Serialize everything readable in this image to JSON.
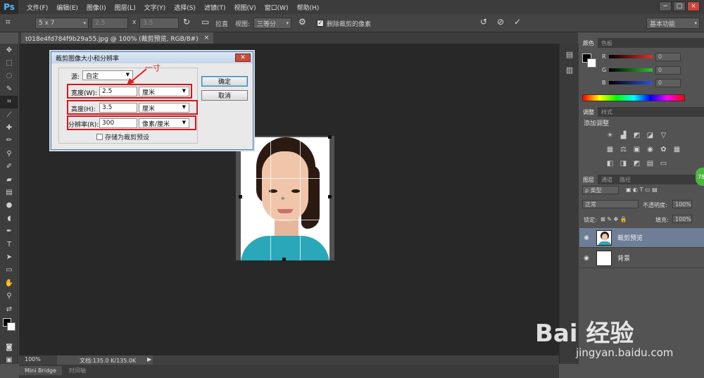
{
  "app": {
    "logo": "Ps",
    "menu": [
      "文件(F)",
      "编辑(E)",
      "图像(I)",
      "图层(L)",
      "文字(Y)",
      "选择(S)",
      "滤镜(T)",
      "视图(V)",
      "窗口(W)",
      "帮助(H)"
    ],
    "window_controls": [
      "−",
      "□",
      "×"
    ]
  },
  "options_bar": {
    "ratio_select": "5 x 7",
    "width_value": "2.5",
    "times": "x",
    "height_value": "3.5",
    "straighten_label": "拉直",
    "view_label": "视图:",
    "view_select": "三等分",
    "delete_cropped_label": "删除裁剪的像素",
    "workspace": "基本功能"
  },
  "document": {
    "tab_title": "t018e4fd784f9b29a55.jpg @ 100% (裁剪预览, RGB/8#)",
    "close_glyph": "×",
    "zoom": "100%",
    "doc_info": "文档:135.0 K/135.0K"
  },
  "dialog": {
    "title": "裁剪图像大小和分辨率",
    "close_glyph": "✕",
    "source_label": "源:",
    "source_value": "自定",
    "width_label": "宽度(W):",
    "width_value": "2.5",
    "width_unit": "厘米",
    "height_label": "高度(H):",
    "height_value": "3.5",
    "height_unit": "厘米",
    "resolution_label": "分辨率(R):",
    "resolution_value": "300",
    "resolution_unit": "像素/厘米",
    "save_preset_label": "存储为裁剪预设",
    "ok_label": "确定",
    "cancel_label": "取消"
  },
  "annotation": {
    "text": "一寸",
    "color": "#e01e1e"
  },
  "bottom_tabs": [
    "Mini Bridge",
    "时间轴"
  ],
  "panels": {
    "color_tabs": [
      "颜色",
      "色板"
    ],
    "channels": [
      {
        "label": "R",
        "value": "0",
        "color": "#e03030"
      },
      {
        "label": "G",
        "value": "0",
        "color": "#30c030"
      },
      {
        "label": "B",
        "value": "0",
        "color": "#3050e0"
      }
    ],
    "adjust_tabs": [
      "调整",
      "样式"
    ],
    "adjust_title": "添加调整",
    "layer_tabs": [
      "图层",
      "通道",
      "路径"
    ],
    "kind_select": "ρ 类型",
    "blend_mode": "正常",
    "opacity_label": "不透明度:",
    "opacity_value": "100%",
    "lock_label": "锁定:",
    "fill_label": "填充:",
    "fill_value": "100%",
    "layers": [
      {
        "name": "裁剪预览",
        "selected": true
      },
      {
        "name": "背景",
        "selected": false
      }
    ],
    "badge": "78"
  },
  "watermark": {
    "paw": "🐾",
    "brand": "Bai  经验",
    "url": "jingyan.baidu.com"
  }
}
